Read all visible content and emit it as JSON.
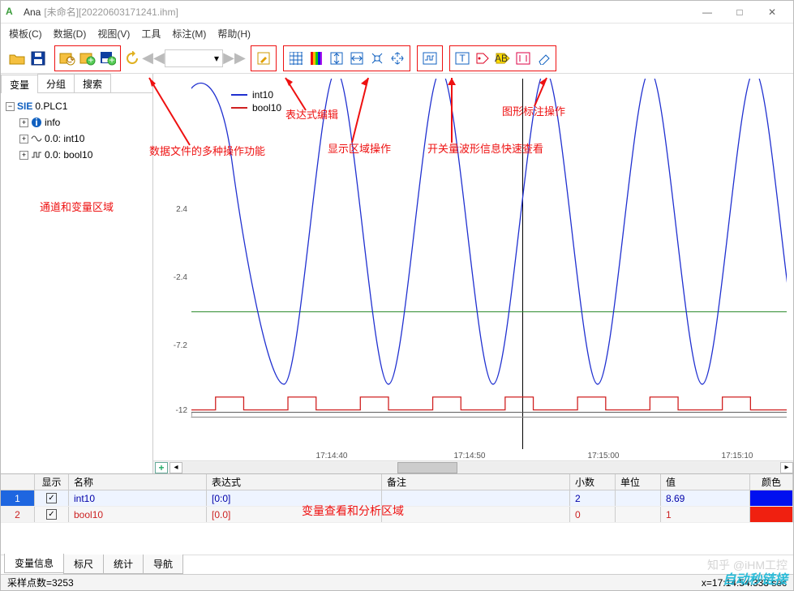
{
  "window": {
    "app": "Ana",
    "subtitle": "[未命名][20220603171241.ihm]",
    "min": "—",
    "max": "□",
    "close": "✕"
  },
  "menu": [
    "模板(C)",
    "数据(D)",
    "视图(V)",
    "工具",
    "标注(M)",
    "帮助(H)"
  ],
  "left": {
    "tabs": [
      "变量",
      "分组",
      "搜索"
    ],
    "tree": {
      "root": "0.PLC1",
      "root_tag": "SIE",
      "nodes": [
        {
          "icon": "info-icon",
          "label": "info"
        },
        {
          "icon": "analog-icon",
          "label": "0.0: int10"
        },
        {
          "icon": "digital-icon",
          "label": "0.0: bool10"
        }
      ]
    },
    "annotation": "通道和变量区域"
  },
  "annotations": {
    "fileops": "数据文件的多种操作功能",
    "expr": "表达式编辑",
    "display": "显示区域操作",
    "digital": "开关量波形信息快速查看",
    "marks": "图形标注操作",
    "gridnote": "变量查看和分析区域"
  },
  "chart_data": {
    "type": "line",
    "series": [
      {
        "name": "int10",
        "color": "#2030d0",
        "kind": "sine",
        "amplitude": 10,
        "offset": 0,
        "period_sec": 5
      },
      {
        "name": "bool10",
        "color": "#d02020",
        "kind": "square",
        "low": -12,
        "high": -11,
        "period_sec": 5
      }
    ],
    "yticks": [
      2.4,
      -2.4,
      -7.2,
      -12
    ],
    "ylim": [
      -12.5,
      10.5
    ],
    "xticks": [
      "17:14:40",
      "17:14:50",
      "17:15:00",
      "17:15:10"
    ],
    "xlim_sec": [
      0,
      40
    ],
    "cursor_x": "17:14:54.333",
    "title": "",
    "xlabel": "",
    "ylabel": ""
  },
  "grid": {
    "headers": [
      "",
      "显示",
      "名称",
      "表达式",
      "备注",
      "小数",
      "单位",
      "值",
      "颜色"
    ],
    "rows": [
      {
        "idx": "1",
        "show": true,
        "name": "int10",
        "expr": "[0:0]",
        "note": "",
        "dec": "2",
        "unit": "",
        "val": "8.69",
        "color": "#0010f0"
      },
      {
        "idx": "2",
        "show": true,
        "name": "bool10",
        "expr": "[0.0]",
        "note": "",
        "dec": "0",
        "unit": "",
        "val": "1",
        "color": "#f02010"
      }
    ]
  },
  "bottomtabs": [
    "变量信息",
    "标尺",
    "统计",
    "导航"
  ],
  "status": {
    "left": "采样点数=3253",
    "right": "x=17:14:54.333 sec"
  },
  "watermark1": "知乎 @iHM工控",
  "watermark2": "自动秒链接"
}
